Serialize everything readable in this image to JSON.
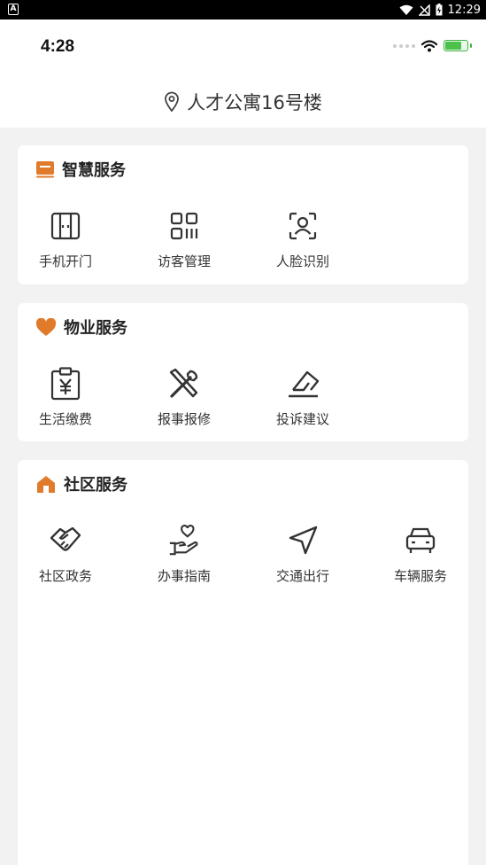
{
  "android_status": {
    "time": "12:29",
    "app_icon": "a-icon"
  },
  "ios_status": {
    "time": "4:28"
  },
  "header": {
    "location": "人才公寓16号楼",
    "location_icon": "map-pin-icon"
  },
  "colors": {
    "accent": "#e07b2c",
    "background": "#f2f2f2",
    "card": "#ffffff"
  },
  "sections": [
    {
      "title": "智慧服务",
      "icon": "smart-card-icon",
      "items": [
        {
          "label": "手机开门",
          "icon": "door-icon"
        },
        {
          "label": "访客管理",
          "icon": "qr-code-icon"
        },
        {
          "label": "人脸识别",
          "icon": "face-scan-icon"
        }
      ]
    },
    {
      "title": "物业服务",
      "icon": "heart-icon",
      "items": [
        {
          "label": "生活缴费",
          "icon": "yuan-bill-icon"
        },
        {
          "label": "报事报修",
          "icon": "tools-icon"
        },
        {
          "label": "投诉建议",
          "icon": "eraser-icon"
        }
      ]
    },
    {
      "title": "社区服务",
      "icon": "home-icon",
      "items": [
        {
          "label": "社区政务",
          "icon": "handshake-icon"
        },
        {
          "label": "办事指南",
          "icon": "hand-heart-icon"
        },
        {
          "label": "交通出行",
          "icon": "navigation-icon"
        },
        {
          "label": "车辆服务",
          "icon": "car-icon"
        }
      ]
    }
  ]
}
